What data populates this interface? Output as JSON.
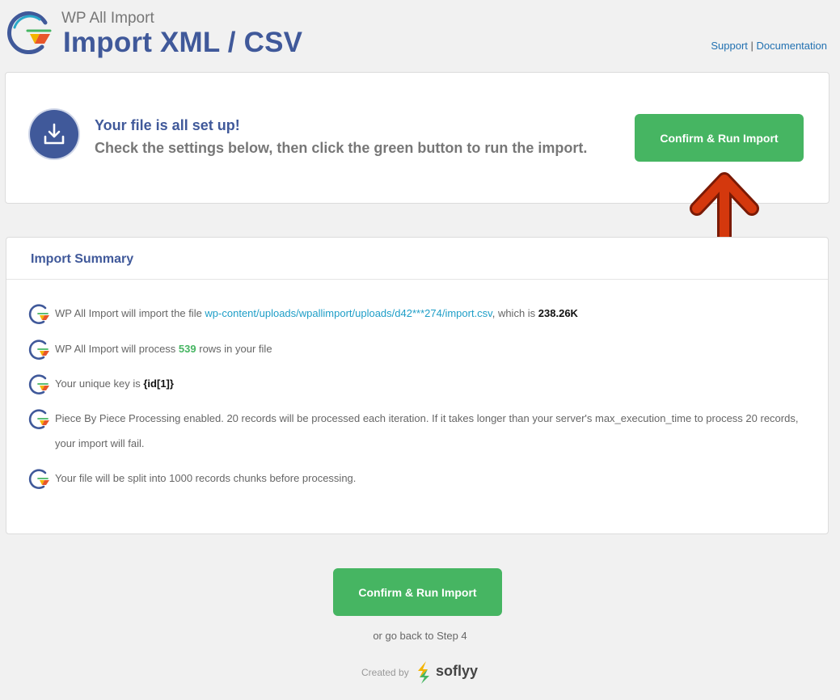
{
  "header": {
    "brand": "WP All Import",
    "title": "Import XML / CSV",
    "support_link": "Support",
    "separator": "|",
    "docs_link": "Documentation"
  },
  "setup": {
    "line1": "Your file is all set up!",
    "line2": "Check the settings below, then click the green button to run the import.",
    "confirm_label": "Confirm & Run Import"
  },
  "summary": {
    "title": "Import Summary",
    "file_pre": "WP All Import will import the file ",
    "file_path": "wp-content/uploads/wpallimport/uploads/d42***274/import.csv",
    "file_mid": ", which is ",
    "file_size": "238.26K",
    "rows_pre": "WP All Import will process ",
    "rows_count": "539",
    "rows_post": " rows in your file",
    "key_pre": "Your unique key is ",
    "key_value": "{id[1]}",
    "piece_line1": "Piece By Piece Processing enabled. 20 records will be processed each iteration. If it takes longer than your server's max_execution_time to process 20 records,",
    "piece_line2": "your import will fail.",
    "split_text": "Your file will be split into 1000 records chunks before processing."
  },
  "footer": {
    "confirm_label": "Confirm & Run Import",
    "go_back": "or go back to Step 4",
    "created_by": "Created by",
    "company": "soflyy"
  },
  "colors": {
    "brand_blue": "#40599a",
    "accent_green": "#46b562",
    "arrow_red": "#d4380d",
    "link_blue": "#2271b1",
    "path_teal": "#1e9ec7"
  },
  "icons": {
    "logo": "wp-all-import-logo",
    "badge": "download-icon",
    "row": "wpai-circle-arrow-icon",
    "annotation": "red-up-arrow"
  }
}
